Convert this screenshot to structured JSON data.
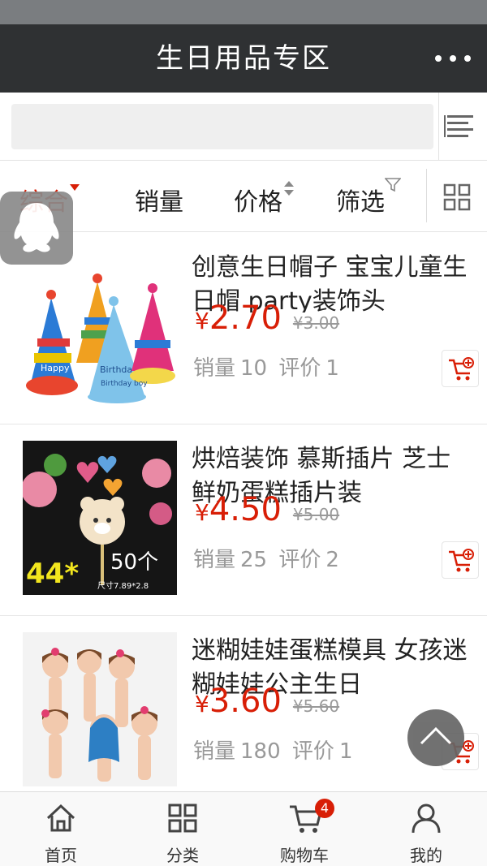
{
  "header": {
    "title": "生日用品专区",
    "more_icon": "more-dots-icon"
  },
  "search": {
    "value": "",
    "placeholder": ""
  },
  "sort_tabs": [
    {
      "label": "综合",
      "active": true
    },
    {
      "label": "销量"
    },
    {
      "label": "价格"
    },
    {
      "label": "筛选"
    }
  ],
  "products": [
    {
      "title": "创意生日帽子 宝宝儿童生日帽 party装饰头",
      "currency": "¥",
      "price": "2.70",
      "original_price": "¥3.00",
      "sales_label": "销量",
      "sales": "10",
      "reviews_label": "评价",
      "reviews": "1",
      "image_text": [
        "Happy",
        "Birthday",
        "Birthday boy"
      ]
    },
    {
      "title": "烘焙装饰 慕斯插片 芝士鲜奶蛋糕插片装",
      "currency": "¥",
      "price": "4.50",
      "original_price": "¥5.00",
      "sales_label": "销量",
      "sales": "25",
      "reviews_label": "评价",
      "reviews": "2",
      "image_text": [
        "44*",
        "50个",
        "尺寸7.89*2.8"
      ]
    },
    {
      "title": "迷糊娃娃蛋糕模具 女孩迷糊娃娃公主生日",
      "currency": "¥",
      "price": "3.60",
      "original_price": "¥5.60",
      "sales_label": "销量",
      "sales": "180",
      "reviews_label": "评价",
      "reviews": "1",
      "image_text": []
    }
  ],
  "tabbar": [
    {
      "label": "首页",
      "icon": "home-icon"
    },
    {
      "label": "分类",
      "icon": "category-grid-icon"
    },
    {
      "label": "购物车",
      "icon": "cart-icon",
      "badge": "4"
    },
    {
      "label": "我的",
      "icon": "user-icon"
    }
  ],
  "colors": {
    "accent": "#d81e06",
    "appbar": "#2f3133"
  }
}
